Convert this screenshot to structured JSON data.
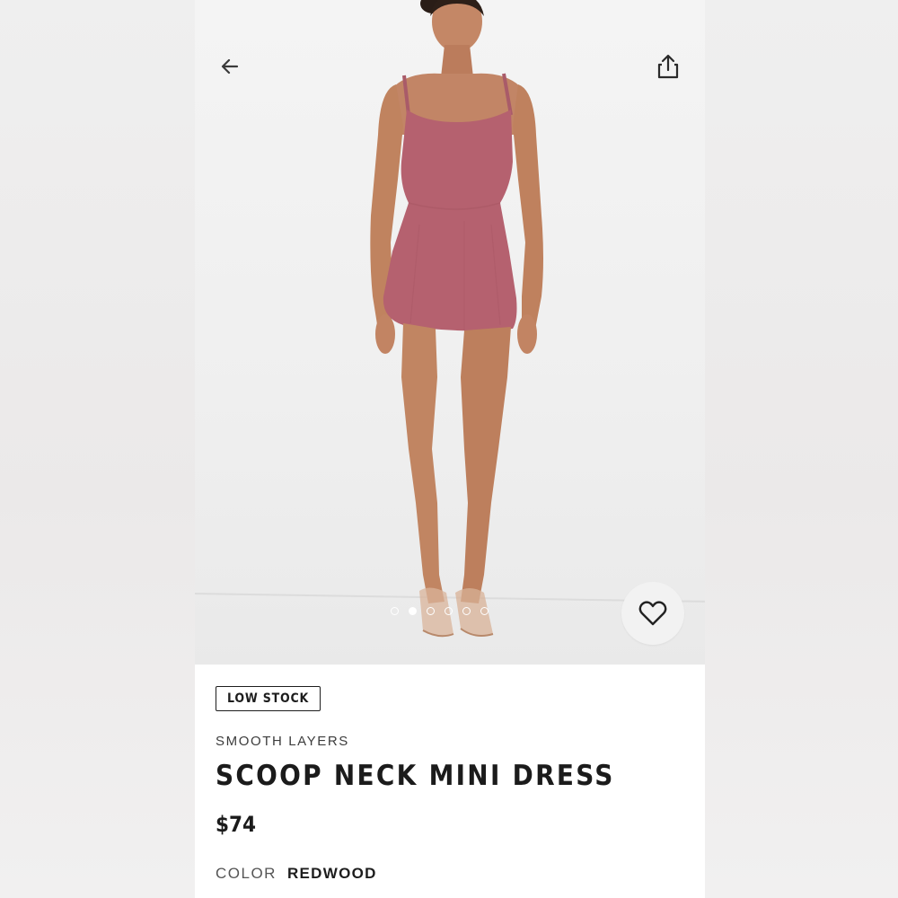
{
  "product": {
    "stock_badge": "LOW STOCK",
    "brand": "SMOOTH LAYERS",
    "title": "SCOOP NECK MINI DRESS",
    "price": "$74",
    "color_label": "COLOR",
    "color_value": "REDWOOD"
  },
  "gallery": {
    "image_count": 6,
    "active_index": 1
  },
  "icons": {
    "back": "arrow-left-icon",
    "share": "share-icon",
    "favorite": "heart-icon"
  },
  "colors": {
    "dress": "#b5616f",
    "text_primary": "#1b1b1b"
  }
}
